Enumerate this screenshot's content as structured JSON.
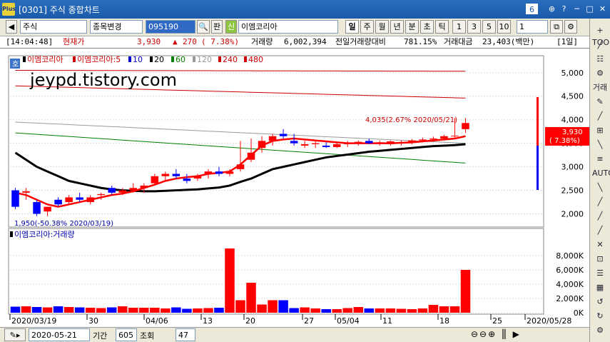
{
  "window": {
    "logo_text": "Plus",
    "title": "[0301] 주식 종합차트",
    "screen_num": "6",
    "controls": [
      "⊕",
      "?",
      "─",
      "□",
      "✕"
    ]
  },
  "toolbar": {
    "nav_left": "◀",
    "nav_right": "▶",
    "market_type": "주식",
    "search_mode": "종목변경",
    "code": "095190",
    "search_icon": "🔍",
    "board_btn": "판",
    "new_tag": "신",
    "stock_name": "이엠코리아",
    "period_buttons": [
      "일",
      "주",
      "월",
      "년",
      "분",
      "초",
      "틱"
    ],
    "active_period": "일",
    "num_buttons": [
      "1",
      "3",
      "5",
      "10"
    ],
    "unit_value": "1"
  },
  "infobar": {
    "time": "[14:04:48]",
    "price_label": "현재가",
    "price": "3,930",
    "arrow": "▲",
    "change": "270",
    "change_pct": "( 7.38%)",
    "volume_label": "거래량",
    "volume": "6,002,394",
    "prev_vol_label": "전일거래량대비",
    "prev_vol_pct": "781.15%",
    "amount_label": "거래대금",
    "amount": "23,403(백만)",
    "period_tag": "[1일]"
  },
  "price_panel": {
    "badge": "호",
    "legend_main": "이엠코리아",
    "legend_price": "이엠코리아:5",
    "ma_labels": [
      "10",
      "20",
      "60",
      "120",
      "240",
      "480"
    ],
    "watermark": "jeypd.tistory.com",
    "y_ticks": [
      "5,000",
      "4,500",
      "4,000",
      "3,500",
      "3,000",
      "2,500",
      "2,000"
    ],
    "current_price": "3,930",
    "current_pct": "( 7.38%)",
    "high_note": "4,035(2.67% 2020/05/21)",
    "low_note": "1,950(-50.38% 2020/03/19)"
  },
  "volume_panel": {
    "legend": "이엠코리아:거래량",
    "y_ticks": [
      "8,000K",
      "6,000K",
      "4,000K",
      "2,000K",
      "0K"
    ]
  },
  "x_axis": {
    "ticks": [
      "2020/03/19",
      "30",
      "04/06",
      "13",
      "20",
      "27",
      "05/04",
      "11",
      "18",
      "25",
      "2020/05/28"
    ]
  },
  "bottombar": {
    "date_value": "2020-05-21",
    "period_label": "기간",
    "period_value": "605",
    "query_label": "조회",
    "count_value": "47"
  },
  "rightbar": {
    "items": [
      "+ TOOL",
      "╱",
      "☷",
      "⚙",
      "거래",
      "✎",
      "╱",
      "⊞",
      "╲",
      "≡",
      "AUTO",
      "╲",
      "╱",
      "╱",
      "╱",
      "✕",
      "⊡",
      "☰",
      "▦",
      "↺",
      "↻",
      "⚙"
    ]
  },
  "colors": {
    "up": "#ff0000",
    "down": "#0000ff",
    "ma5": "#ff0000",
    "ma10": "#0000cc",
    "ma20": "#000000",
    "ma60": "#008000",
    "ma120": "#9a9a9a",
    "ma240": "#cc0000",
    "ma480": "#cc0000"
  },
  "chart_data": {
    "type": "candlestick",
    "x": [
      "03/19",
      "03/20",
      "03/23",
      "03/24",
      "03/25",
      "03/26",
      "03/27",
      "03/30",
      "03/31",
      "04/01",
      "04/02",
      "04/03",
      "04/06",
      "04/07",
      "04/08",
      "04/09",
      "04/10",
      "04/13",
      "04/14",
      "04/16",
      "04/17",
      "04/20",
      "04/21",
      "04/22",
      "04/23",
      "04/24",
      "04/27",
      "04/28",
      "04/29",
      "05/04",
      "05/06",
      "05/07",
      "05/08",
      "05/11",
      "05/12",
      "05/13",
      "05/14",
      "05/15",
      "05/18",
      "05/19",
      "05/20",
      "05/21",
      "05/22"
    ],
    "ohlc": [
      [
        2500,
        2550,
        2100,
        2150
      ],
      [
        2450,
        2550,
        2300,
        2480
      ],
      [
        2250,
        2300,
        1950,
        2000
      ],
      [
        2050,
        2150,
        1950,
        2150
      ],
      [
        2300,
        2350,
        2150,
        2200
      ],
      [
        2250,
        2400,
        2200,
        2350
      ],
      [
        2350,
        2450,
        2250,
        2300
      ],
      [
        2250,
        2400,
        2200,
        2350
      ],
      [
        2400,
        2450,
        2300,
        2420
      ],
      [
        2550,
        2600,
        2400,
        2450
      ],
      [
        2450,
        2550,
        2400,
        2500
      ],
      [
        2500,
        2650,
        2450,
        2550
      ],
      [
        2550,
        2650,
        2450,
        2600
      ],
      [
        2650,
        2850,
        2600,
        2800
      ],
      [
        2800,
        2900,
        2700,
        2850
      ],
      [
        2850,
        2950,
        2750,
        2800
      ],
      [
        2750,
        2850,
        2650,
        2700
      ],
      [
        2750,
        2850,
        2700,
        2800
      ],
      [
        2850,
        2950,
        2750,
        2900
      ],
      [
        2900,
        3000,
        2800,
        2850
      ],
      [
        2850,
        2950,
        2800,
        2900
      ],
      [
        2950,
        3550,
        2900,
        3050
      ],
      [
        3150,
        3600,
        3100,
        3300
      ],
      [
        3400,
        3650,
        3300,
        3550
      ],
      [
        3550,
        3700,
        3450,
        3650
      ],
      [
        3700,
        3800,
        3600,
        3650
      ],
      [
        3550,
        3700,
        3450,
        3500
      ],
      [
        3450,
        3550,
        3400,
        3480
      ],
      [
        3480,
        3550,
        3400,
        3500
      ],
      [
        3450,
        3520,
        3400,
        3420
      ],
      [
        3420,
        3520,
        3400,
        3480
      ],
      [
        3480,
        3550,
        3420,
        3500
      ],
      [
        3500,
        3560,
        3450,
        3530
      ],
      [
        3550,
        3600,
        3480,
        3500
      ],
      [
        3500,
        3560,
        3450,
        3520
      ],
      [
        3480,
        3560,
        3450,
        3540
      ],
      [
        3500,
        3560,
        3450,
        3520
      ],
      [
        3530,
        3590,
        3480,
        3560
      ],
      [
        3560,
        3620,
        3520,
        3580
      ],
      [
        3580,
        3640,
        3540,
        3600
      ],
      [
        3600,
        3680,
        3560,
        3650
      ],
      [
        3660,
        4035,
        3620,
        3660
      ],
      [
        3800,
        4035,
        3720,
        3930
      ]
    ],
    "volume_k": [
      850,
      900,
      800,
      750,
      900,
      800,
      750,
      700,
      650,
      750,
      900,
      700,
      700,
      700,
      600,
      750,
      550,
      600,
      650,
      700,
      9000,
      1750,
      4200,
      1150,
      1750,
      1750,
      650,
      750,
      600,
      500,
      500,
      650,
      800,
      600,
      600,
      600,
      550,
      500,
      600,
      1100,
      900,
      900,
      6000
    ],
    "y_range": [
      1750,
      5300
    ],
    "vol_range": [
      0,
      10000
    ],
    "ma": {
      "ma5": [
        2450,
        2400,
        2300,
        2200,
        2150,
        2200,
        2250,
        2300,
        2350,
        2400,
        2430,
        2480,
        2550,
        2620,
        2700,
        2750,
        2780,
        2800,
        2850,
        2870,
        2900,
        3050,
        3250,
        3450,
        3550,
        3580,
        3600,
        3580,
        3560,
        3540,
        3520,
        3500,
        3500,
        3500,
        3500,
        3500,
        3510,
        3520,
        3540,
        3560,
        3580,
        3600,
        3650
      ],
      "ma20": [
        3300,
        3150,
        3000,
        2900,
        2800,
        2700,
        2650,
        2600,
        2550,
        2520,
        2500,
        2490,
        2480,
        2480,
        2490,
        2500,
        2510,
        2520,
        2540,
        2560,
        2600,
        2680,
        2750,
        2850,
        2950,
        3000,
        3050,
        3100,
        3150,
        3200,
        3230,
        3260,
        3290,
        3320,
        3340,
        3360,
        3380,
        3400,
        3420,
        3440,
        3450,
        3460,
        3480
      ]
    }
  }
}
